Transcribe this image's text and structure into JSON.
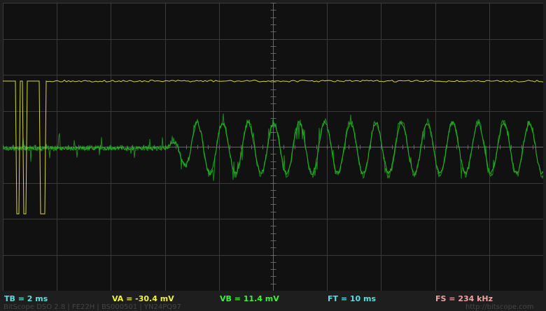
{
  "colors": {
    "background": "#1e1e1e",
    "screen": "#111111",
    "grid": "#3a3a3a",
    "center_axis": "#666666",
    "channel_a": "#d6d63a",
    "channel_b": "#21b321",
    "timebase_text": "#55e0e0",
    "va_text": "#f2f23a",
    "vb_text": "#3af23a",
    "ft_text": "#55e0e0",
    "fs_text": "#f2a0a0"
  },
  "status_bar": {
    "timebase": "TB = 2 ms",
    "channel_a": "VA = -30.4 mV",
    "channel_b": "VB = 11.4 mV",
    "frame_time": "FT = 10 ms",
    "sample_rate": "FS = 234 kHz"
  },
  "footer": {
    "device": "BitScope DSO 2.8 | FE22H | BS000501 | YN24PQ97",
    "url": "http://bitscope.com"
  }
}
